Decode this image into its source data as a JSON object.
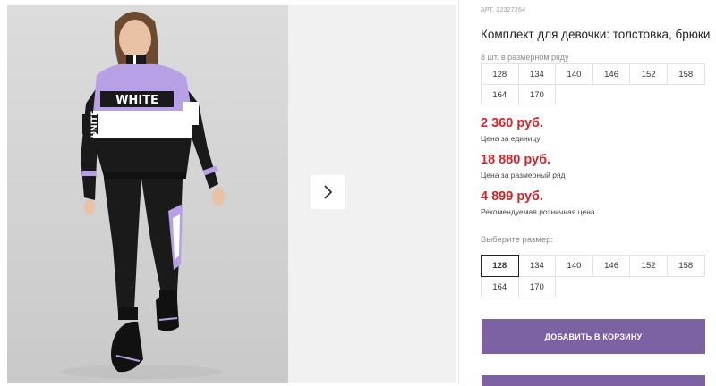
{
  "product": {
    "article": "АРТ. 22327264",
    "title": "Комплект для девочки: толстовка, брюки",
    "image_alt": "Girl in purple-white-black tracksuit"
  },
  "row_sizes": {
    "caption": "8 шт. в размерном ряду",
    "sizes": [
      "128",
      "134",
      "140",
      "146",
      "152",
      "158",
      "164",
      "170"
    ]
  },
  "prices": {
    "unit_price": "2 360 руб.",
    "unit_label": "Цена за единицу",
    "row_price": "18 880 руб.",
    "row_label": "Цена за размерный ряд",
    "retail_price": "4 899 руб.",
    "retail_label": "Рекомендуемая розничная цена"
  },
  "size_select": {
    "caption": "Выберите размер:",
    "selected": "128",
    "sizes": [
      "128",
      "134",
      "140",
      "146",
      "152",
      "158",
      "164",
      "170"
    ]
  },
  "actions": {
    "add_to_cart": "ДОБАВИТЬ В КОРЗИНУ"
  },
  "print": {
    "chest_word": "WHITE",
    "sleeve_word": "UNITE"
  },
  "colors": {
    "accent": "#7d62a3",
    "price": "#d4252b",
    "lavender": "#b7a0e6"
  },
  "icons": {
    "gallery_next": "chevron-right-icon"
  }
}
